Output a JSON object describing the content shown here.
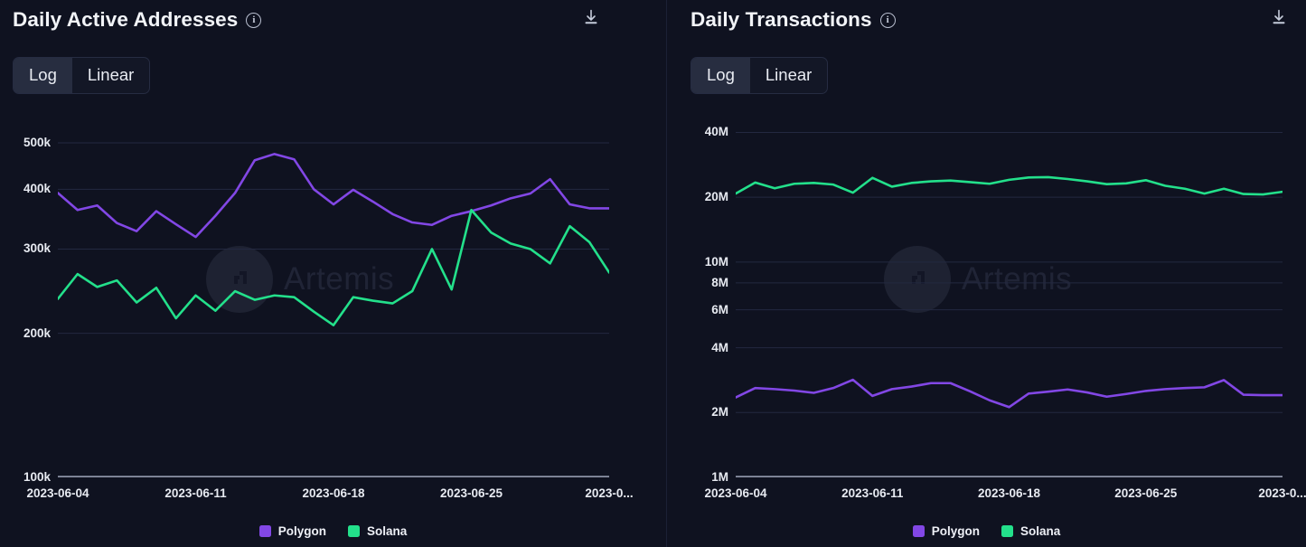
{
  "theme": {
    "background": "#0f1220",
    "grid": "#232840",
    "axis": "#8b91a6",
    "text": "#e7eaf1",
    "polygon": "#8247e5",
    "solana": "#23e08b"
  },
  "watermark": {
    "text": "Artemis",
    "logo_icon": "artemis-logo-icon"
  },
  "panels": [
    {
      "id": "daily-active-addresses",
      "title": "Daily Active Addresses",
      "info_icon": "info-icon",
      "download_icon": "download-icon",
      "scale_toggle": {
        "options": [
          "Log",
          "Linear"
        ],
        "selected": "Log"
      },
      "chart_data": {
        "type": "line",
        "title": "Daily Active Addresses",
        "xlabel": "",
        "ylabel": "",
        "yscale": "log",
        "ylim": [
          100000,
          560000
        ],
        "yticks": [
          100000,
          200000,
          300000,
          400000,
          500000
        ],
        "ytick_labels": [
          "100k",
          "200k",
          "300k",
          "400k",
          "500k"
        ],
        "grid": true,
        "legend_position": "bottom",
        "xtick_labels": [
          "2023-06-04",
          "2023-06-11",
          "2023-06-18",
          "2023-06-25",
          "2023-0..."
        ],
        "xtick_index": [
          0,
          7,
          14,
          21,
          28
        ],
        "x": [
          "2023-06-04",
          "2023-06-05",
          "2023-06-06",
          "2023-06-07",
          "2023-06-08",
          "2023-06-09",
          "2023-06-10",
          "2023-06-11",
          "2023-06-12",
          "2023-06-13",
          "2023-06-14",
          "2023-06-15",
          "2023-06-16",
          "2023-06-17",
          "2023-06-18",
          "2023-06-19",
          "2023-06-20",
          "2023-06-21",
          "2023-06-22",
          "2023-06-23",
          "2023-06-24",
          "2023-06-25",
          "2023-06-26",
          "2023-06-27",
          "2023-06-28",
          "2023-06-29",
          "2023-06-30",
          "2023-07-01",
          "2023-07-02"
        ],
        "series": [
          {
            "name": "Polygon",
            "color": "#8247e5",
            "values": [
              393000,
              362000,
              370000,
              340000,
              327000,
              360000,
              338000,
              318000,
              352000,
              393000,
              460000,
              474000,
              462000,
              400000,
              372000,
              399000,
              377000,
              355000,
              341000,
              337000,
              352000,
              360000,
              370000,
              383000,
              392000,
              420000,
              372000,
              365000,
              365000
            ]
          },
          {
            "name": "Solana",
            "color": "#23e08b",
            "values": [
              236000,
              266000,
              250000,
              258000,
              232000,
              249000,
              215000,
              240000,
              223000,
              245000,
              235000,
              240000,
              238000,
              222000,
              208000,
              238000,
              234000,
              231000,
              245000,
              300000,
              247000,
              362000,
              325000,
              308000,
              300000,
              280000,
              335000,
              310000,
              268000
            ]
          }
        ]
      },
      "legend": [
        {
          "label": "Polygon",
          "color": "#8247e5"
        },
        {
          "label": "Solana",
          "color": "#23e08b"
        }
      ]
    },
    {
      "id": "daily-transactions",
      "title": "Daily Transactions",
      "info_icon": "info-icon",
      "download_icon": "download-icon",
      "scale_toggle": {
        "options": [
          "Log",
          "Linear"
        ],
        "selected": "Log"
      },
      "chart_data": {
        "type": "line",
        "title": "Daily Transactions",
        "xlabel": "",
        "ylabel": "",
        "yscale": "log",
        "ylim": [
          1000000,
          46000000
        ],
        "yticks": [
          1000000,
          2000000,
          4000000,
          6000000,
          8000000,
          10000000,
          20000000,
          40000000
        ],
        "ytick_labels": [
          "1M",
          "2M",
          "4M",
          "6M",
          "8M",
          "10M",
          "20M",
          "40M"
        ],
        "grid": true,
        "legend_position": "bottom",
        "xtick_labels": [
          "2023-06-04",
          "2023-06-11",
          "2023-06-18",
          "2023-06-25",
          "2023-0..."
        ],
        "xtick_index": [
          0,
          7,
          14,
          21,
          28
        ],
        "x": [
          "2023-06-04",
          "2023-06-05",
          "2023-06-06",
          "2023-06-07",
          "2023-06-08",
          "2023-06-09",
          "2023-06-10",
          "2023-06-11",
          "2023-06-12",
          "2023-06-13",
          "2023-06-14",
          "2023-06-15",
          "2023-06-16",
          "2023-06-17",
          "2023-06-18",
          "2023-06-19",
          "2023-06-20",
          "2023-06-21",
          "2023-06-22",
          "2023-06-23",
          "2023-06-24",
          "2023-06-25",
          "2023-06-26",
          "2023-06-27",
          "2023-06-28",
          "2023-06-29",
          "2023-06-30",
          "2023-07-01",
          "2023-07-02"
        ],
        "series": [
          {
            "name": "Solana",
            "color": "#23e08b",
            "values": [
              20800000,
              23400000,
              22000000,
              23100000,
              23300000,
              22900000,
              21000000,
              24600000,
              22400000,
              23300000,
              23700000,
              23900000,
              23500000,
              23100000,
              24100000,
              24700000,
              24800000,
              24300000,
              23700000,
              23000000,
              23200000,
              24000000,
              22600000,
              21900000,
              20800000,
              21900000,
              20700000,
              20600000,
              21200000
            ]
          },
          {
            "name": "Polygon",
            "color": "#8247e5",
            "values": [
              2350000,
              2600000,
              2570000,
              2530000,
              2470000,
              2600000,
              2840000,
              2390000,
              2570000,
              2640000,
              2740000,
              2740000,
              2510000,
              2280000,
              2120000,
              2450000,
              2500000,
              2560000,
              2480000,
              2370000,
              2440000,
              2520000,
              2570000,
              2600000,
              2620000,
              2830000,
              2420000,
              2410000,
              2410000
            ]
          }
        ]
      },
      "legend": [
        {
          "label": "Polygon",
          "color": "#8247e5"
        },
        {
          "label": "Solana",
          "color": "#23e08b"
        }
      ]
    }
  ]
}
